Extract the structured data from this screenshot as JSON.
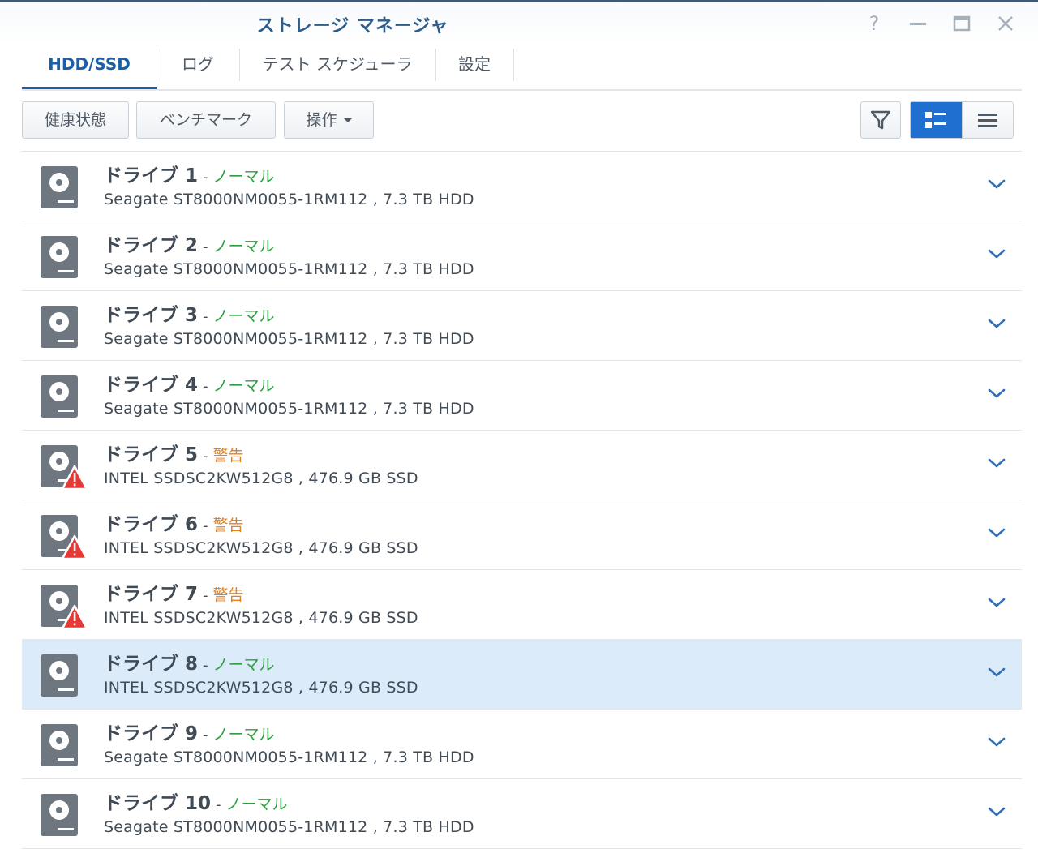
{
  "window": {
    "title": "ストレージ マネージャ",
    "help_glyph": "?",
    "controls": [
      "help-icon",
      "minimize-icon",
      "maximize-icon",
      "close-icon"
    ]
  },
  "tabs": [
    {
      "label": "HDD/SSD",
      "active": true
    },
    {
      "label": "ログ",
      "active": false
    },
    {
      "label": "テスト スケジューラ",
      "active": false
    },
    {
      "label": "設定",
      "active": false
    }
  ],
  "toolbar": {
    "health_label": "健康状態",
    "benchmark_label": "ベンチマーク",
    "action_label": "操作",
    "filter_icon": "filter-icon",
    "view_icons": [
      "detail-list-view-icon",
      "compact-list-view-icon"
    ]
  },
  "colors": {
    "accent": "#1e6fd0",
    "title": "#2f5d8a",
    "normal": "#2e9e3e",
    "warning": "#e3811c",
    "selected_row": "#dcebfa",
    "disk_icon": "#6e7780",
    "warning_badge": "#e53935"
  },
  "drives": [
    {
      "name": "ドライブ 1",
      "separator": "-",
      "status": "ノーマル",
      "status_type": "normal",
      "description": "Seagate ST8000NM0055-1RM112 , 7.3 TB HDD",
      "selected": false
    },
    {
      "name": "ドライブ 2",
      "separator": "-",
      "status": "ノーマル",
      "status_type": "normal",
      "description": "Seagate ST8000NM0055-1RM112 , 7.3 TB HDD",
      "selected": false
    },
    {
      "name": "ドライブ 3",
      "separator": "-",
      "status": "ノーマル",
      "status_type": "normal",
      "description": "Seagate ST8000NM0055-1RM112 , 7.3 TB HDD",
      "selected": false
    },
    {
      "name": "ドライブ 4",
      "separator": "-",
      "status": "ノーマル",
      "status_type": "normal",
      "description": "Seagate ST8000NM0055-1RM112 , 7.3 TB HDD",
      "selected": false
    },
    {
      "name": "ドライブ 5",
      "separator": "-",
      "status": "警告",
      "status_type": "warn",
      "description": "INTEL SSDSC2KW512G8 , 476.9 GB SSD",
      "selected": false
    },
    {
      "name": "ドライブ 6",
      "separator": "-",
      "status": "警告",
      "status_type": "warn",
      "description": "INTEL SSDSC2KW512G8 , 476.9 GB SSD",
      "selected": false
    },
    {
      "name": "ドライブ 7",
      "separator": "-",
      "status": "警告",
      "status_type": "warn",
      "description": "INTEL SSDSC2KW512G8 , 476.9 GB SSD",
      "selected": false
    },
    {
      "name": "ドライブ 8",
      "separator": "-",
      "status": "ノーマル",
      "status_type": "normal",
      "description": "INTEL SSDSC2KW512G8 , 476.9 GB SSD",
      "selected": true
    },
    {
      "name": "ドライブ 9",
      "separator": "-",
      "status": "ノーマル",
      "status_type": "normal",
      "description": "Seagate ST8000NM0055-1RM112 , 7.3 TB HDD",
      "selected": false
    },
    {
      "name": "ドライブ 10",
      "separator": "-",
      "status": "ノーマル",
      "status_type": "normal",
      "description": "Seagate ST8000NM0055-1RM112 , 7.3 TB HDD",
      "selected": false
    }
  ]
}
